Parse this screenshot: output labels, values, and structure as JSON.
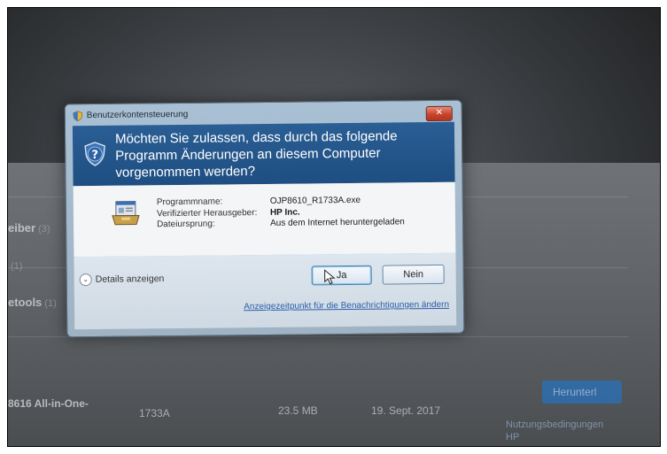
{
  "dialog": {
    "title": "Benutzerkontensteuerung",
    "header_text": "Möchten Sie zulassen, dass durch das folgende Programm Änderungen an diesem Computer vorgenommen werden?",
    "labels": {
      "program_name": "Programmname:",
      "publisher": "Verifizierter Herausgeber:",
      "origin": "Dateiursprung:"
    },
    "values": {
      "program_name": "OJP8610_R1733A.exe",
      "publisher": "HP Inc.",
      "origin": "Aus dem Internet heruntergeladen"
    },
    "details_label": "Details anzeigen",
    "yes_label": "Ja",
    "no_label": "Nein",
    "notification_link": "Anzeigezeitpunkt für die Benachrichtigungen ändern",
    "close_glyph": "✕"
  },
  "background": {
    "row1_label": "eiber",
    "row1_count": "(3)",
    "row2_count": "(1)",
    "row3_label": "etools",
    "row3_count": "(1)",
    "product_name": "8616 All-in-One-",
    "version": "1733A",
    "size": "23.5 MB",
    "date": "19. Sept. 2017",
    "download_button": "Herunterl",
    "terms_link_1": "Nutzungsbedingungen",
    "terms_link_2": "HP"
  },
  "colors": {
    "header_blue": "#1e4e82",
    "link_blue": "#2a5ea8",
    "close_red": "#c8432a"
  },
  "icons": {
    "title": "uac-shield-icon",
    "header": "question-shield-icon",
    "program": "program-installer-icon",
    "close": "close-icon",
    "details": "chevron-down-icon",
    "cursor": "mouse-pointer-icon"
  }
}
